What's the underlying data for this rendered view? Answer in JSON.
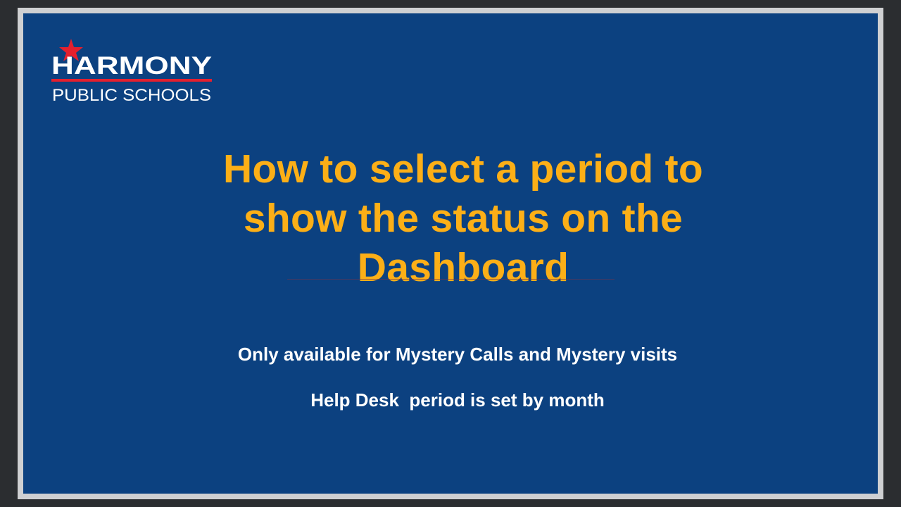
{
  "logo": {
    "wordmark": "HARMONY",
    "subtext": "PUBLIC SCHOOLS",
    "colors": {
      "white": "#ffffff",
      "red": "#e4202e",
      "navy": "#0c4180"
    }
  },
  "slide": {
    "title_line1": "How to select a period to",
    "title_line2": "show the status on the",
    "title_line3": "Dashboard",
    "subtitle1": "Only available for Mystery Calls and Mystery visits",
    "subtitle2": "Help Desk  period is set by month"
  },
  "colors": {
    "background": "#0c4180",
    "title": "#fcaf17",
    "body_text": "#ffffff",
    "outer": "#2b2d30",
    "frame": "#cfd0d2"
  }
}
